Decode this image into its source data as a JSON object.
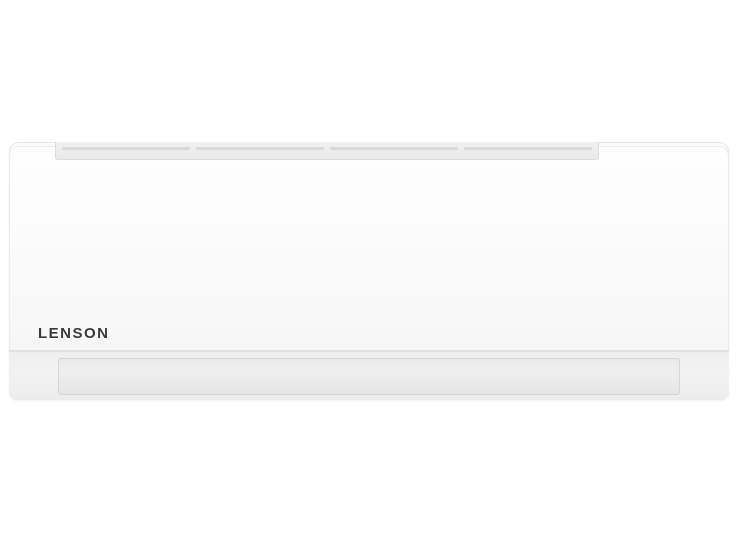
{
  "product": {
    "type": "wall-mounted split air conditioner indoor unit",
    "brand_logo_text": "LENSON",
    "colors": {
      "background": "#ffffff",
      "unit_body": "#f7f7f7",
      "logo": "#3a3a3a"
    }
  }
}
